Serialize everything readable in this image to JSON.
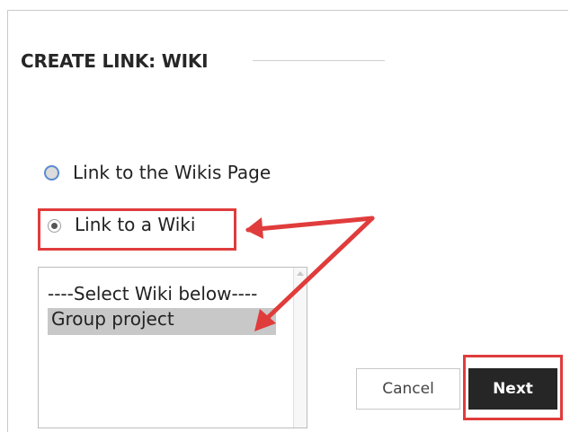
{
  "dialog": {
    "title": "CREATE LINK: WIKI"
  },
  "options": {
    "link_wikis_page": {
      "label": "Link to the Wikis Page",
      "selected": false
    },
    "link_wiki": {
      "label": "Link to a Wiki",
      "selected": true
    }
  },
  "wiki_list": {
    "items": [
      "----Select Wiki below----",
      "Group project"
    ],
    "selected": "Group project"
  },
  "buttons": {
    "cancel": "Cancel",
    "next": "Next"
  },
  "annotation": {
    "color": "#e03c3c"
  }
}
